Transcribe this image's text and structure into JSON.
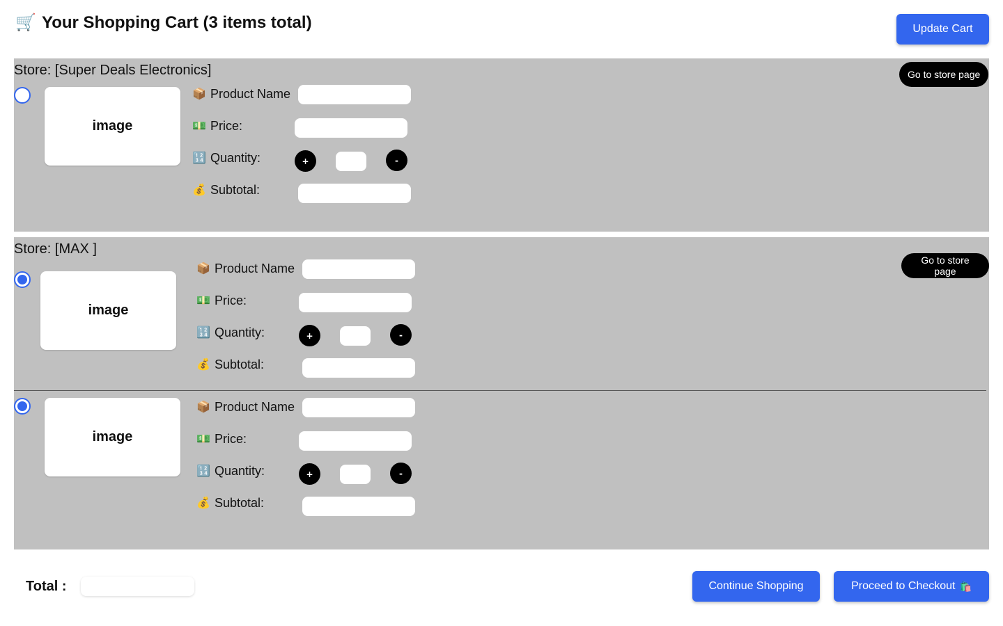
{
  "header": {
    "cart_icon": "🛒",
    "title": "Your Shopping Cart (3 items total)",
    "update_label": "Update Cart"
  },
  "icons": {
    "product": "📦",
    "price": "💵",
    "quantity": "🔢",
    "subtotal": "💰"
  },
  "colors": {
    "accent": "#3366ee",
    "store_bg": "#c0c0c0"
  },
  "stores": [
    {
      "name": "Store: [Super Deals Electronics]",
      "store_page_label": "Go to store page",
      "items": [
        {
          "selected": false,
          "image_label": "image",
          "product_label": "Product Name",
          "price_label": "Price:",
          "quantity_label": "Quantity:",
          "subtotal_label": "Subtotal:",
          "plus_label": "+",
          "minus_label": "-"
        }
      ]
    },
    {
      "name": "Store: [MAX ]",
      "store_page_label": "Go to store page",
      "items": [
        {
          "selected": true,
          "image_label": "image",
          "product_label": "Product Name",
          "price_label": "Price:",
          "quantity_label": "Quantity:",
          "subtotal_label": "Subtotal:",
          "plus_label": "+",
          "minus_label": "-"
        },
        {
          "selected": true,
          "image_label": "image",
          "product_label": "Product Name",
          "price_label": "Price:",
          "quantity_label": "Quantity:",
          "subtotal_label": "Subtotal:",
          "plus_label": "+",
          "minus_label": "-"
        }
      ]
    }
  ],
  "footer": {
    "total_label": "Total :",
    "continue_label": "Continue Shopping",
    "checkout_label": "Proceed to Checkout",
    "checkout_icon": "🛍️"
  }
}
